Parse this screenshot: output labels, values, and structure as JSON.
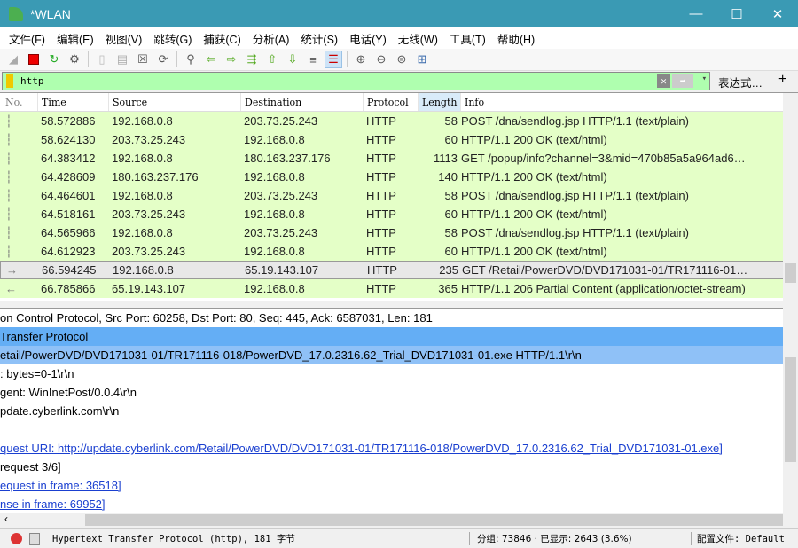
{
  "window": {
    "title": "*WLAN",
    "minimize": "—",
    "maximize": "☐",
    "close": "✕"
  },
  "menu": [
    "文件(F)",
    "编辑(E)",
    "视图(V)",
    "跳转(G)",
    "捕获(C)",
    "分析(A)",
    "统计(S)",
    "电话(Y)",
    "无线(W)",
    "工具(T)",
    "帮助(H)"
  ],
  "filter": {
    "value": "http",
    "expression_label": "表达式…",
    "add_label": "+",
    "clear": "✕",
    "apply": "➡",
    "dropdown": "▾"
  },
  "packet_list": {
    "columns": [
      "No.",
      "Time",
      "Source",
      "Destination",
      "Protocol",
      "Length",
      "Info"
    ],
    "rows": [
      {
        "time": "58.572886",
        "src": "192.168.0.8",
        "dst": "203.73.25.243",
        "proto": "HTTP",
        "len": "58",
        "info": "POST /dna/sendlog.jsp HTTP/1.1  (text/plain)"
      },
      {
        "time": "58.624130",
        "src": "203.73.25.243",
        "dst": "192.168.0.8",
        "proto": "HTTP",
        "len": "60",
        "info": "HTTP/1.1 200 OK  (text/html)"
      },
      {
        "time": "64.383412",
        "src": "192.168.0.8",
        "dst": "180.163.237.176",
        "proto": "HTTP",
        "len": "1113",
        "info": "GET /popup/info?channel=3&mid=470b85a5a964ad6…"
      },
      {
        "time": "64.428609",
        "src": "180.163.237.176",
        "dst": "192.168.0.8",
        "proto": "HTTP",
        "len": "140",
        "info": "HTTP/1.1 200 OK  (text/html)"
      },
      {
        "time": "64.464601",
        "src": "192.168.0.8",
        "dst": "203.73.25.243",
        "proto": "HTTP",
        "len": "58",
        "info": "POST /dna/sendlog.jsp HTTP/1.1  (text/plain)"
      },
      {
        "time": "64.518161",
        "src": "203.73.25.243",
        "dst": "192.168.0.8",
        "proto": "HTTP",
        "len": "60",
        "info": "HTTP/1.1 200 OK  (text/html)"
      },
      {
        "time": "64.565966",
        "src": "192.168.0.8",
        "dst": "203.73.25.243",
        "proto": "HTTP",
        "len": "58",
        "info": "POST /dna/sendlog.jsp HTTP/1.1  (text/plain)"
      },
      {
        "time": "64.612923",
        "src": "203.73.25.243",
        "dst": "192.168.0.8",
        "proto": "HTTP",
        "len": "60",
        "info": "HTTP/1.1 200 OK  (text/html)"
      },
      {
        "time": "66.594245",
        "src": "192.168.0.8",
        "dst": "65.19.143.107",
        "proto": "HTTP",
        "len": "235",
        "info": "GET /Retail/PowerDVD/DVD171031-01/TR171116-01…",
        "selected": true,
        "marker": "→"
      },
      {
        "time": "66.785866",
        "src": "65.19.143.107",
        "dst": "192.168.0.8",
        "proto": "HTTP",
        "len": "365",
        "info": "HTTP/1.1 206 Partial Content  (application/octet-stream)",
        "marker": "←"
      }
    ]
  },
  "details": [
    "on Control Protocol, Src Port: 60258, Dst Port: 80, Seq: 445, Ack: 6587031, Len: 181",
    " Transfer Protocol",
    "etail/PowerDVD/DVD171031-01/TR171116-018/PowerDVD_17.0.2316.62_Trial_DVD171031-01.exe HTTP/1.1\\r\\n",
    ": bytes=0-1\\r\\n",
    "gent: WinInetPost/0.0.4\\r\\n",
    "pdate.cyberlink.com\\r\\n",
    "",
    "quest URI: http://update.cyberlink.com/Retail/PowerDVD/DVD171031-01/TR171116-018/PowerDVD_17.0.2316.62_Trial_DVD171031-01.exe]",
    "request 3/6]",
    "equest in frame: 36518]",
    "nse in frame: 69952]"
  ],
  "status": {
    "text": "Hypertext Transfer Protocol (http), 181 字节",
    "packets": "分组: 73846 · 已显示: 2643 (3.6%)",
    "profile": "配置文件: Default"
  }
}
